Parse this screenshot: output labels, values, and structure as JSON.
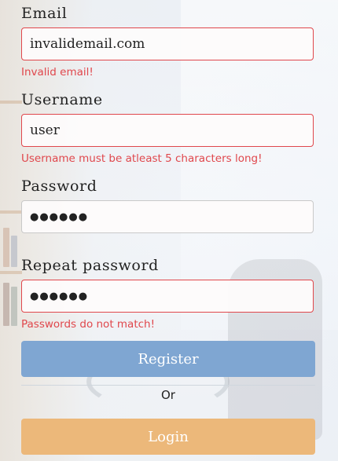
{
  "form": {
    "email": {
      "label": "Email",
      "value": "invalidemail.com",
      "error": "Invalid email!"
    },
    "username": {
      "label": "Username",
      "value": "user",
      "error": "Username must be atleast 5 characters long!"
    },
    "password": {
      "label": "Password",
      "value": "●●●●●●"
    },
    "repeat_password": {
      "label": "Repeat password",
      "value": "●●●●●●",
      "error": "Passwords do not match!"
    },
    "register_label": "Register",
    "or_label": "Or",
    "login_label": "Login"
  },
  "colors": {
    "error": "#e0474c",
    "register_button": "#7fa6d2",
    "login_button": "#ecb87a"
  }
}
